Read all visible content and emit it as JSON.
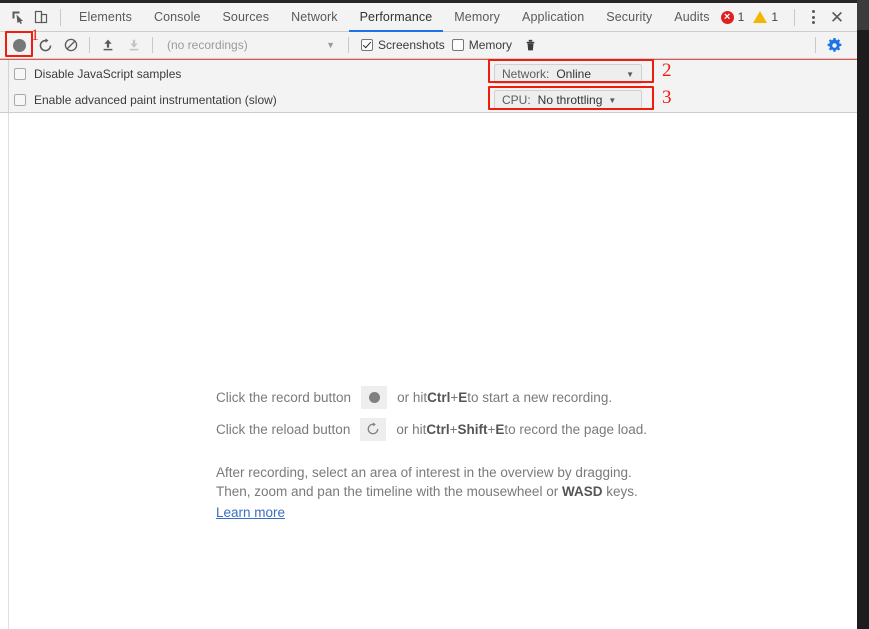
{
  "window": {
    "devtools_tab_icons": {
      "inspect": "inspect-element-icon",
      "device": "device-toolbar-icon"
    }
  },
  "tabbar": {
    "tabs": [
      {
        "label": "Elements",
        "active": false
      },
      {
        "label": "Console",
        "active": false
      },
      {
        "label": "Sources",
        "active": false
      },
      {
        "label": "Network",
        "active": false
      },
      {
        "label": "Performance",
        "active": true
      },
      {
        "label": "Memory",
        "active": false
      },
      {
        "label": "Application",
        "active": false
      },
      {
        "label": "Security",
        "active": false
      },
      {
        "label": "Audits",
        "active": false
      }
    ],
    "error_count": "1",
    "warning_count": "1",
    "more_tools_icon": "kebab-menu-icon",
    "close_icon": "close-icon",
    "accent_active": "#1a73e8",
    "error_color": "#e02020",
    "warning_color": "#f2b705"
  },
  "toolbar": {
    "record_title": "record-button",
    "reload_title": "reload-and-record-button",
    "clear_title": "clear-button",
    "load_title": "load-profile-button",
    "save_title": "save-profile-button",
    "recordings_value": "(no recordings)",
    "screenshots_label": "Screenshots",
    "screenshots_checked": true,
    "memory_label": "Memory",
    "memory_checked": false,
    "trash_title": "collect-garbage-button",
    "settings_title": "capture-settings-button",
    "settings_color": "#1a73e8"
  },
  "settings": {
    "disable_js_samples_label": "Disable JavaScript samples",
    "disable_js_samples_checked": false,
    "advanced_paint_label": "Enable advanced paint instrumentation (slow)",
    "advanced_paint_checked": false,
    "network": {
      "label": "Network:",
      "value": "Online"
    },
    "cpu": {
      "label": "CPU:",
      "value": "No throttling"
    }
  },
  "annotations": {
    "color": "#f01c0e",
    "items": [
      {
        "number": "1",
        "target": "record-button"
      },
      {
        "number": "2",
        "target": "network-throttling-dropdown"
      },
      {
        "number": "3",
        "target": "cpu-throttling-dropdown"
      }
    ]
  },
  "empty_state": {
    "line1_prefix": "Click the record button",
    "line1_suffix_a": "or hit ",
    "line1_key1": "Ctrl",
    "line1_plus1": " + ",
    "line1_key2": "E",
    "line1_suffix_b": " to start a new recording.",
    "line2_prefix": "Click the reload button",
    "line2_suffix_a": "or hit ",
    "line2_key1": "Ctrl",
    "line2_plus1": " + ",
    "line2_key2": "Shift",
    "line2_plus2": " + ",
    "line2_key3": "E",
    "line2_suffix_b": " to record the page load.",
    "para_line1": "After recording, select an area of interest in the overview by dragging.",
    "para_line2_a": "Then, zoom and pan the timeline with the mousewheel or ",
    "para_line2_key": "WASD",
    "para_line2_b": " keys.",
    "learn_more": "Learn more",
    "learn_more_color": "#3a6fbf"
  }
}
